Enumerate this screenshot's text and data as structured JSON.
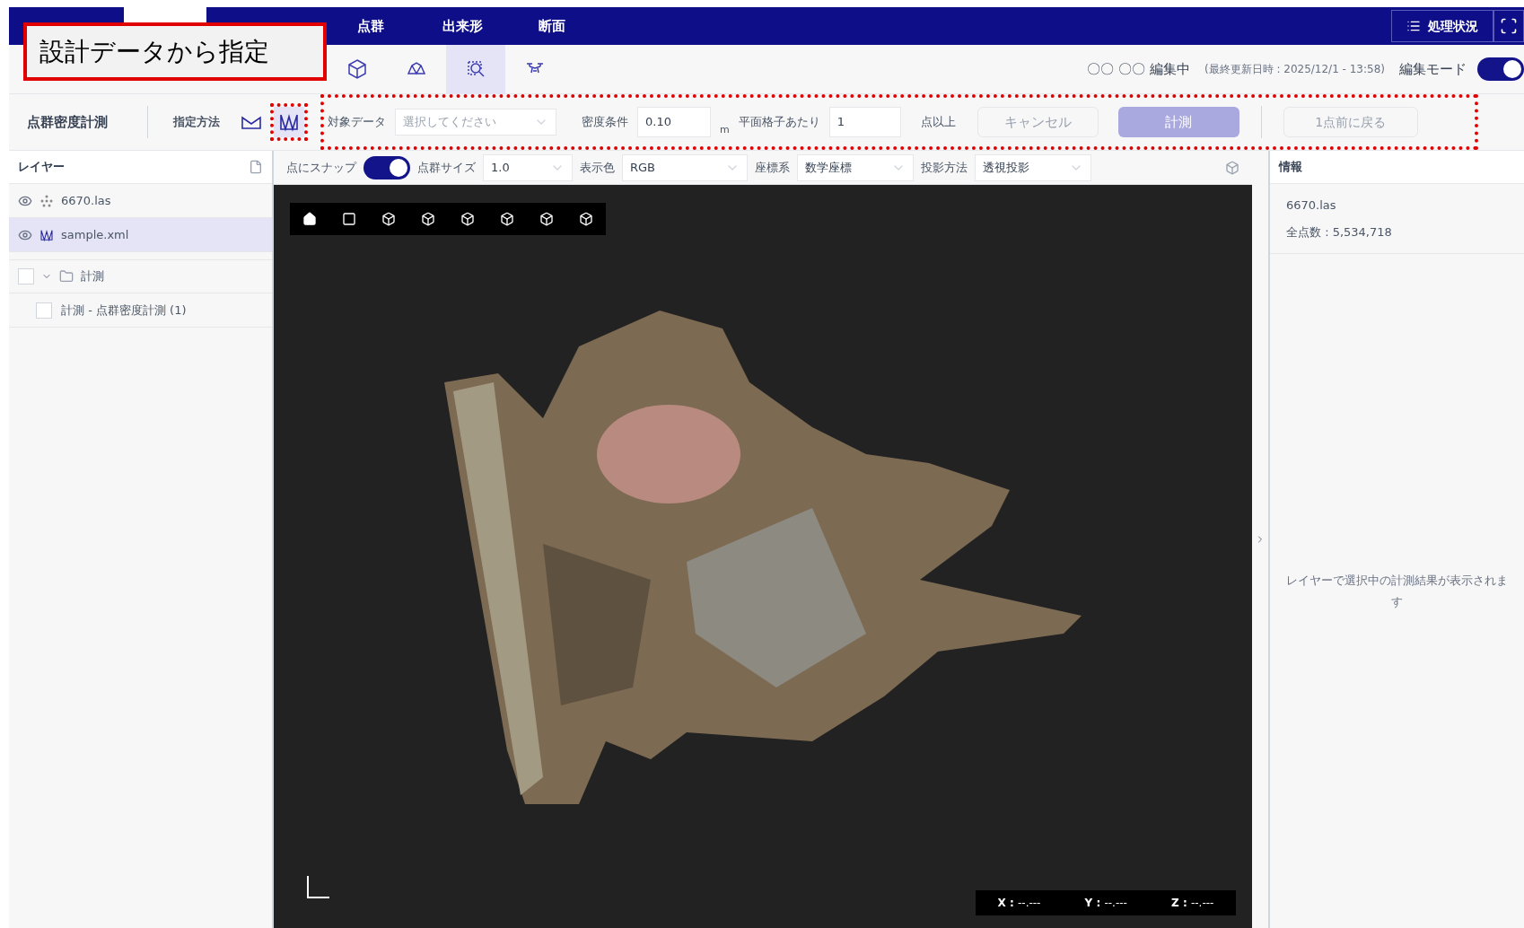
{
  "callout": {
    "text": "設計データから指定"
  },
  "menu_tabs": [
    {
      "selected": false
    },
    {
      "selected": true
    },
    {
      "selected": false
    },
    {
      "label": "点群",
      "selected": false
    },
    {
      "label": "出来形",
      "selected": false
    },
    {
      "label": "断面",
      "selected": false
    }
  ],
  "status_button": {
    "label": "処理状況"
  },
  "toolbar": {
    "tools": [
      {
        "kind": "cube",
        "selected": false
      },
      {
        "kind": "dome",
        "selected": false
      },
      {
        "kind": "select",
        "selected": true
      },
      {
        "kind": "drone",
        "selected": false
      }
    ],
    "editor": "〇〇 〇〇 編集中",
    "last_updated": "(最終更新日時 : 2025/12/1 - 13:58)",
    "edit_mode": {
      "label": "編集モード",
      "on": true
    }
  },
  "measure_bar": {
    "title": "点群密度計測",
    "method_label": "指定方法",
    "methods": [
      {
        "kind": "surface",
        "selected": false
      },
      {
        "kind": "design",
        "selected": true
      }
    ],
    "target": {
      "label": "対象データ",
      "placeholder": "選択してください"
    },
    "density": {
      "label": "密度条件",
      "value": "0.10",
      "unit": "m"
    },
    "grid": {
      "label": "平面格子あたり",
      "value": "1",
      "suffix": "点以上"
    },
    "buttons": [
      {
        "label": "キャンセル",
        "kind": "secondary",
        "disabled": true
      },
      {
        "label": "計測",
        "kind": "primary",
        "disabled": true
      }
    ],
    "undo": {
      "label": "1点前に戻る",
      "disabled": true
    }
  },
  "layers": {
    "title": "レイヤー",
    "items": [
      {
        "name": "6670.las",
        "kind": "pointcloud",
        "visible": true,
        "selected": false
      },
      {
        "name": "sample.xml",
        "kind": "design",
        "visible": true,
        "selected": true
      },
      {
        "name": "計測",
        "kind": "folder",
        "expanded": true,
        "checked": false,
        "children": [
          {
            "name": "計測 - 点群密度計測 (1)",
            "checked": false
          }
        ]
      }
    ]
  },
  "view_bar": {
    "snap": {
      "label": "点にスナップ",
      "on": true
    },
    "point_size": {
      "label": "点群サイズ",
      "value": "1.0"
    },
    "color": {
      "label": "表示色",
      "value": "RGB"
    },
    "coords": {
      "label": "座標系",
      "value": "数学座標"
    },
    "projection": {
      "label": "投影方法",
      "value": "透視投影"
    }
  },
  "viewport": {
    "coordinates": [
      {
        "axis": "X :",
        "value": "--.---"
      },
      {
        "axis": "Y :",
        "value": "--.---"
      },
      {
        "axis": "Z :",
        "value": "--.---"
      }
    ]
  },
  "info": {
    "title": "情報",
    "file": "6670.las",
    "points": "全点数 : 5,534,718",
    "empty_message": "レイヤーで選択中の計測結果が表示されます"
  }
}
